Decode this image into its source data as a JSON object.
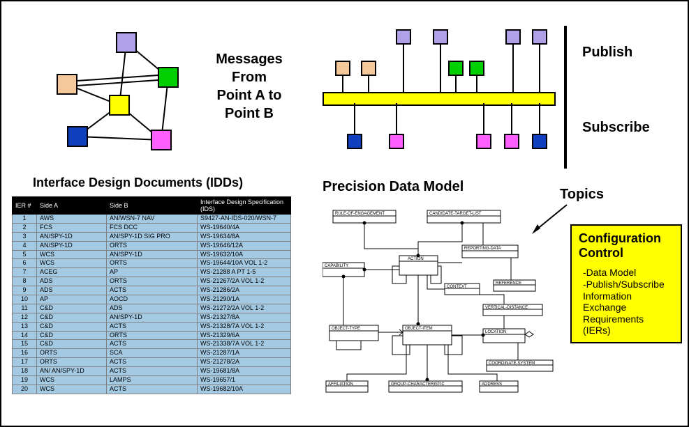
{
  "messages_block": {
    "line1": "Messages",
    "line2": "From",
    "line3": "Point A to",
    "line4": "Point B"
  },
  "right_labels": {
    "publish": "Publish",
    "subscribe": "Subscribe",
    "topics": "Topics"
  },
  "idd_title": "Interface Design Documents (IDDs)",
  "pdm_title": "Precision Data Model",
  "idd_table": {
    "headers": [
      "IER #",
      "Side A",
      "Side B",
      "Interface Design Specification (IDS)"
    ],
    "rows": [
      [
        "1",
        "AWS",
        "AN/WSN-7 NAV",
        "S9427-AN-IDS-020/WSN-7"
      ],
      [
        "2",
        "FCS",
        "FCS DCC",
        "WS-19640/4A"
      ],
      [
        "3",
        "AN/SPY-1D",
        "AN/SPY-1D SIG PRO",
        "WS-19634/8A"
      ],
      [
        "4",
        "AN/SPY-1D",
        "ORTS",
        "WS-19646/12A"
      ],
      [
        "5",
        "WCS",
        "AN/SPY-1D",
        "WS-19632/10A"
      ],
      [
        "6",
        "WCS",
        "ORTS",
        "WS-19644/10A VOL 1-2"
      ],
      [
        "7",
        "ACEG",
        "AP",
        "WS-21288 A PT 1-5"
      ],
      [
        "8",
        "ADS",
        "ORTS",
        "WS-21267/2A VOL 1-2"
      ],
      [
        "9",
        "ADS",
        "ACTS",
        "WS-21286/2A"
      ],
      [
        "10",
        "AP",
        "AOCD",
        "WS-21290/1A"
      ],
      [
        "11",
        "C&D",
        "ADS",
        "WS-21272/2A VOL 1-2"
      ],
      [
        "12",
        "C&D",
        "AN/SPY-1D",
        "WS-21327/8A"
      ],
      [
        "13",
        "C&D",
        "ACTS",
        "WS-21328/7A VOL 1-2"
      ],
      [
        "14",
        "C&D",
        "ORTS",
        "WS-21329/6A"
      ],
      [
        "15",
        "C&D",
        "ACTS",
        "WS-21338/7A VOL 1-2"
      ],
      [
        "16",
        "ORTS",
        "SCA",
        "WS-21287/1A"
      ],
      [
        "17",
        "ORTS",
        "ACTS",
        "WS-21278/2A"
      ],
      [
        "18",
        "AN/ AN/SPY-1D",
        "ACTS",
        "WS-19681/8A"
      ],
      [
        "19",
        "WCS",
        "LAMPS",
        "WS-19657/1"
      ],
      [
        "20",
        "WCS",
        "ACTS",
        "WS-19682/10A"
      ]
    ]
  },
  "config_control": {
    "title_line1": "Configuration",
    "title_line2": "Control",
    "items": [
      "-Data Model",
      "-Publish/Subscribe",
      "Information Exchange",
      "Requirements (IERs)"
    ]
  },
  "er_entities": {
    "rule_of_engagement": "RULE-OF-ENGAGEMENT",
    "candidate_target_list": "CANDIDATE-TARGET-LIST",
    "capability": "CAPABILITY",
    "action": "ACTION",
    "reporting_data": "REPORTING-DATA",
    "context": "CONTEXT",
    "reference": "REFERENCE",
    "vertical_distance": "VERTICAL-DISTANCE",
    "object_type": "OBJECT-TYPE",
    "object_item": "OBJECT-ITEM",
    "location": "LOCATION",
    "coordinate_system": "COORDINATE-SYSTEM",
    "affiliation": "AFFILIATION",
    "group_characteristic": "GROUP-CHARACTERISTIC",
    "address": "ADDRESS"
  },
  "colors": {
    "lavender": "#b0a0e8",
    "peach": "#f4c89a",
    "green": "#00d000",
    "yellow": "#ffff00",
    "blue": "#1040c0",
    "magenta": "#ff60ff"
  }
}
